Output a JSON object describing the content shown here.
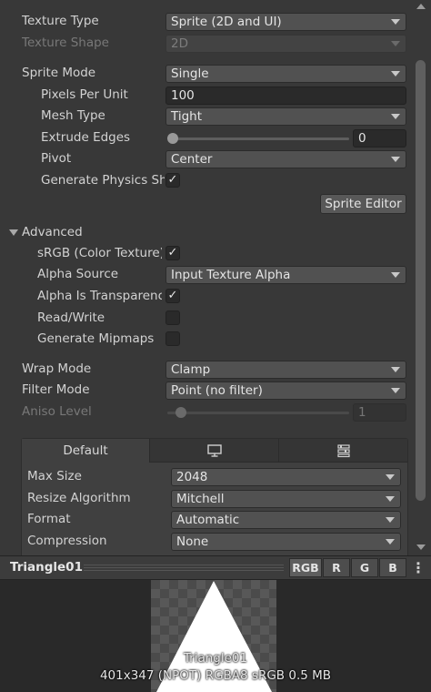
{
  "settings": {
    "texture_type": {
      "label": "Texture Type",
      "value": "Sprite (2D and UI)"
    },
    "texture_shape": {
      "label": "Texture Shape",
      "value": "2D"
    },
    "sprite_mode": {
      "label": "Sprite Mode",
      "value": "Single"
    },
    "pixels_per_unit": {
      "label": "Pixels Per Unit",
      "value": "100"
    },
    "mesh_type": {
      "label": "Mesh Type",
      "value": "Tight"
    },
    "extrude_edges": {
      "label": "Extrude Edges",
      "value": "0",
      "level": 0
    },
    "pivot": {
      "label": "Pivot",
      "value": "Center"
    },
    "generate_physics_shape": {
      "label": "Generate Physics Shape",
      "checked": true
    },
    "sprite_editor_label": "Sprite Editor"
  },
  "advanced": {
    "title": "Advanced",
    "srgb": {
      "label": "sRGB (Color Texture)",
      "checked": true
    },
    "alpha_source": {
      "label": "Alpha Source",
      "value": "Input Texture Alpha"
    },
    "alpha_is_transparency": {
      "label": "Alpha Is Transparency",
      "checked": true
    },
    "read_write": {
      "label": "Read/Write",
      "checked": false
    },
    "generate_mipmaps": {
      "label": "Generate Mipmaps",
      "checked": false
    }
  },
  "sampling": {
    "wrap_mode": {
      "label": "Wrap Mode",
      "value": "Clamp"
    },
    "filter_mode": {
      "label": "Filter Mode",
      "value": "Point (no filter)"
    },
    "aniso_level": {
      "label": "Aniso Level",
      "value": "1",
      "level": 0.06
    }
  },
  "platform": {
    "tabs": [
      {
        "label": "Default",
        "icon": ""
      },
      {
        "label": "",
        "icon": "monitor-icon"
      },
      {
        "label": "",
        "icon": "sliders-icon"
      }
    ],
    "max_size": {
      "label": "Max Size",
      "value": "2048"
    },
    "resize_algorithm": {
      "label": "Resize Algorithm",
      "value": "Mitchell"
    },
    "format": {
      "label": "Format",
      "value": "Automatic"
    },
    "compression": {
      "label": "Compression",
      "value": "None"
    }
  },
  "preview": {
    "title": "Triangle01",
    "channels": [
      "RGB",
      "R",
      "G",
      "B"
    ],
    "active_channel": "RGB",
    "name_overlay": "Triangle01",
    "info": "401x347 (NPOT)  RGBA8 sRGB   0.5 MB"
  },
  "colors": {
    "background": "#383838",
    "field": "#2a2a2a",
    "dropdown": "#515151",
    "text": "#d2d2d2"
  }
}
